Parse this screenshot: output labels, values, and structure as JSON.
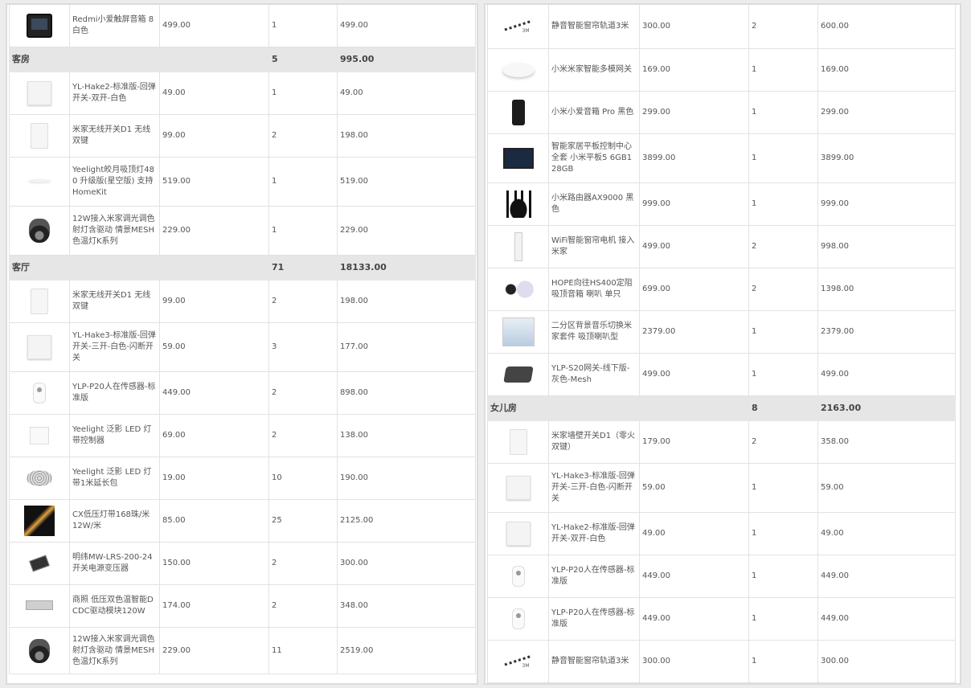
{
  "left": {
    "rows": [
      {
        "kind": "item",
        "img": "tablet-icon",
        "name": "Redmi小爱触屏音箱 8 白色",
        "price": "499.00",
        "qty": "1",
        "total": "499.00",
        "h": 53
      },
      {
        "kind": "room",
        "name": "客房",
        "qty": "5",
        "total": "995.00",
        "h": 31
      },
      {
        "kind": "item",
        "img": "switch-icon",
        "name": "YL-Hake2-标准版-回弹开关-双开-白色",
        "price": "49.00",
        "qty": "1",
        "total": "49.00",
        "h": 53
      },
      {
        "kind": "item",
        "img": "switch-tall-icon",
        "name": "米家无线开关D1 无线双键",
        "price": "99.00",
        "qty": "2",
        "total": "198.00",
        "h": 53
      },
      {
        "kind": "item",
        "img": "ceiling-light-icon",
        "name": "Yeelight皎月吸顶灯480 升级版(星空版) 支持HomeKit",
        "price": "519.00",
        "qty": "1",
        "total": "519.00",
        "h": 61
      },
      {
        "kind": "item",
        "img": "spotlight-icon",
        "name": "12W接入米家调光调色射灯含驱动 情景MESH色温灯K系列",
        "price": "229.00",
        "qty": "1",
        "total": "229.00",
        "h": 61
      },
      {
        "kind": "room",
        "name": "客厅",
        "qty": "71",
        "total": "18133.00",
        "h": 31
      },
      {
        "kind": "item",
        "img": "switch-tall-icon",
        "name": "米家无线开关D1 无线双键",
        "price": "99.00",
        "qty": "2",
        "total": "198.00",
        "h": 53
      },
      {
        "kind": "item",
        "img": "switch-icon",
        "name": "YL-Hake3-标准版-回弹开关-三开-白色-闪断开关",
        "price": "59.00",
        "qty": "3",
        "total": "177.00",
        "h": 61
      },
      {
        "kind": "item",
        "img": "sensor-icon",
        "name": "YLP-P20人在传感器-标准版",
        "price": "449.00",
        "qty": "2",
        "total": "898.00",
        "h": 53
      },
      {
        "kind": "item",
        "img": "controller-icon",
        "name": "Yeelight 泛影 LED 灯带控制器",
        "price": "69.00",
        "qty": "2",
        "total": "138.00",
        "h": 53
      },
      {
        "kind": "item",
        "img": "led-coil-icon",
        "name": "Yeelight 泛影 LED 灯带1米延长包",
        "price": "19.00",
        "qty": "10",
        "total": "190.00",
        "h": 53
      },
      {
        "kind": "item",
        "img": "light-strip-icon",
        "name": "CX低压灯带168珠/米 12W/米",
        "price": "85.00",
        "qty": "25",
        "total": "2125.00",
        "h": 53
      },
      {
        "kind": "item",
        "img": "power-supply-icon",
        "name": "明纬MW-LRS-200-24 开关电源变压器",
        "price": "150.00",
        "qty": "2",
        "total": "300.00",
        "h": 53
      },
      {
        "kind": "item",
        "img": "driver-module-icon",
        "name": "商照 低压双色温智能DCDC驱动模块120W",
        "price": "174.00",
        "qty": "2",
        "total": "348.00",
        "h": 53
      },
      {
        "kind": "item",
        "img": "spotlight-icon",
        "name": "12W接入米家调光调色射灯含驱动 情景MESH色温灯K系列",
        "price": "229.00",
        "qty": "11",
        "total": "2519.00",
        "h": 58
      }
    ]
  },
  "right": {
    "rows": [
      {
        "kind": "item",
        "img": "curtain-rail-icon",
        "name": "静音智能窗帘轨道3米",
        "price": "300.00",
        "qty": "2",
        "total": "600.00",
        "h": 55
      },
      {
        "kind": "item",
        "img": "hub-icon",
        "name": "小米米家智能多模网关",
        "price": "169.00",
        "qty": "1",
        "total": "169.00",
        "h": 53
      },
      {
        "kind": "item",
        "img": "speaker-icon",
        "name": "小米小爱音箱 Pro 黑色",
        "price": "299.00",
        "qty": "1",
        "total": "299.00",
        "h": 53
      },
      {
        "kind": "item",
        "img": "tablet-pad-icon",
        "name": "智能家居平板控制中心全套 小米平板5 6GB128GB",
        "price": "3899.00",
        "qty": "1",
        "total": "3899.00",
        "h": 61
      },
      {
        "kind": "item",
        "img": "router-icon",
        "name": "小米路由器AX9000 黑色",
        "price": "999.00",
        "qty": "1",
        "total": "999.00",
        "h": 53
      },
      {
        "kind": "item",
        "img": "curtain-motor-icon",
        "name": "WiFi智能窗帘电机 接入米家",
        "price": "499.00",
        "qty": "2",
        "total": "998.00",
        "h": 53
      },
      {
        "kind": "item",
        "img": "ceiling-speaker-icon",
        "name": "HOPE向往HS400定阻吸顶音箱 喇叭 单只",
        "price": "699.00",
        "qty": "2",
        "total": "1398.00",
        "h": 53
      },
      {
        "kind": "item",
        "img": "music-kit-icon",
        "name": "二分区背景音乐切换米家套件 吸顶喇叭型",
        "price": "2379.00",
        "qty": "1",
        "total": "2379.00",
        "h": 53
      },
      {
        "kind": "item",
        "img": "gateway-icon",
        "name": "YLP-S20网关-线下版-灰色-Mesh",
        "price": "499.00",
        "qty": "1",
        "total": "499.00",
        "h": 53
      },
      {
        "kind": "room",
        "name": "女儿房",
        "qty": "8",
        "total": "2163.00",
        "h": 31
      },
      {
        "kind": "item",
        "img": "switch-tall-icon",
        "name": "米家墙壁开关D1（零火双键）",
        "price": "179.00",
        "qty": "2",
        "total": "358.00",
        "h": 53
      },
      {
        "kind": "item",
        "img": "switch-icon",
        "name": "YL-Hake3-标准版-回弹开关-三开-白色-闪断开关",
        "price": "59.00",
        "qty": "1",
        "total": "59.00",
        "h": 61
      },
      {
        "kind": "item",
        "img": "switch-icon",
        "name": "YL-Hake2-标准版-回弹开关-双开-白色",
        "price": "49.00",
        "qty": "1",
        "total": "49.00",
        "h": 53
      },
      {
        "kind": "item",
        "img": "sensor-icon",
        "name": "YLP-P20人在传感器-标准版",
        "price": "449.00",
        "qty": "1",
        "total": "449.00",
        "h": 53
      },
      {
        "kind": "item",
        "img": "sensor-icon",
        "name": "YLP-P20人在传感器-标准版",
        "price": "449.00",
        "qty": "1",
        "total": "449.00",
        "h": 53
      },
      {
        "kind": "item",
        "img": "curtain-rail-icon",
        "name": "静音智能窗帘轨道3米",
        "price": "300.00",
        "qty": "1",
        "total": "300.00",
        "h": 53
      }
    ]
  },
  "rail_tag": "3M"
}
